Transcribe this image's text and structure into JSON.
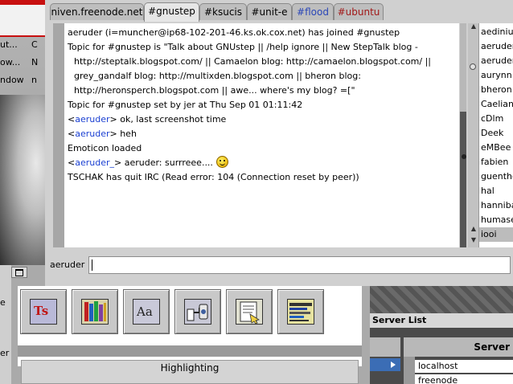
{
  "background": {
    "menu_rows": [
      {
        "text": "ut...",
        "key": "C"
      },
      {
        "text": "ow...",
        "key": "N"
      },
      {
        "text": "ndow",
        "key": "n"
      }
    ],
    "lower_left_texts": [
      "e",
      "er"
    ]
  },
  "tabs": [
    {
      "label": "niven.freenode.net",
      "color": "#000000",
      "active": false
    },
    {
      "label": "#gnustep",
      "color": "#000000",
      "active": true
    },
    {
      "label": "#ksucis",
      "color": "#000000",
      "active": false
    },
    {
      "label": "#unit-e",
      "color": "#000000",
      "active": false
    },
    {
      "label": "#flood",
      "color": "#2a46b8",
      "active": false
    },
    {
      "label": "#ubuntu",
      "color": "#a11818",
      "active": false
    }
  ],
  "chat_lines": [
    {
      "parts": [
        {
          "t": "aeruder (i=muncher@ip68-102-201-46.ks.ok.cox.net) has joined #gnustep"
        }
      ]
    },
    {
      "parts": [
        {
          "t": "Topic for #gnustep is \"Talk about GNUstep || /help ignore || New StepTalk blog -"
        }
      ]
    },
    {
      "cont": true,
      "parts": [
        {
          "t": "http://steptalk.blogspot.com/ || Camaelon blog: http://camaelon.blogspot.com/ ||"
        }
      ]
    },
    {
      "cont": true,
      "parts": [
        {
          "t": "grey_gandalf blog: http://multixden.blogspot.com || bheron blog:"
        }
      ]
    },
    {
      "cont": true,
      "parts": [
        {
          "t": "http://heronsperch.blogspot.com || awe... where's my blog? =[\""
        }
      ]
    },
    {
      "parts": [
        {
          "t": "Topic for #gnustep set by jer at Thu Sep 01 01:11:42"
        }
      ]
    },
    {
      "parts": [
        {
          "t": "<"
        },
        {
          "t": "aeruder",
          "nick": true
        },
        {
          "t": "> ok, last screenshot time"
        }
      ]
    },
    {
      "parts": [
        {
          "t": "<"
        },
        {
          "t": "aeruder",
          "nick": true
        },
        {
          "t": "> heh"
        }
      ]
    },
    {
      "parts": [
        {
          "t": "Emoticon loaded"
        }
      ]
    },
    {
      "smiley": true,
      "parts": [
        {
          "t": "<"
        },
        {
          "t": "aeruder_",
          "nick": true
        },
        {
          "t": "> aeruder: surrreee...."
        }
      ]
    },
    {
      "parts": [
        {
          "t": "TSCHAK has quit IRC (Read error: 104 (Connection reset by peer))"
        }
      ]
    }
  ],
  "users": [
    "aedinius",
    "aeruder",
    "aeruder_",
    "aurynn",
    "bheron",
    "Caelian",
    "cDlm",
    "Deek",
    "eMBee",
    "fabien",
    "guenther",
    "hal",
    "hannibal",
    "humasect",
    "iooi"
  ],
  "selected_user": "iooi",
  "input": {
    "nick_label": "aeruder",
    "value": ""
  },
  "toolbar": {
    "tools": [
      {
        "name": "ts-tool",
        "glyph": "Ts",
        "bg": "#b9b9d8"
      },
      {
        "name": "bookshelf-tool",
        "glyph": "",
        "bg": "#d9d2a8"
      },
      {
        "name": "font-tool",
        "glyph": "Aa",
        "bg": "#c9c9d9"
      },
      {
        "name": "plugin-tool",
        "glyph": "",
        "bg": "#c8c8d6"
      },
      {
        "name": "document-tool",
        "glyph": "",
        "bg": "#e0e0d0"
      },
      {
        "name": "bitmap-font-tool",
        "glyph": "",
        "bg": "#e6e2a0"
      }
    ],
    "highlight_tab": "Highlighting"
  },
  "server_panel": {
    "title": "Server List",
    "column": "Server",
    "entries": [
      "localhost",
      "freenode"
    ]
  }
}
